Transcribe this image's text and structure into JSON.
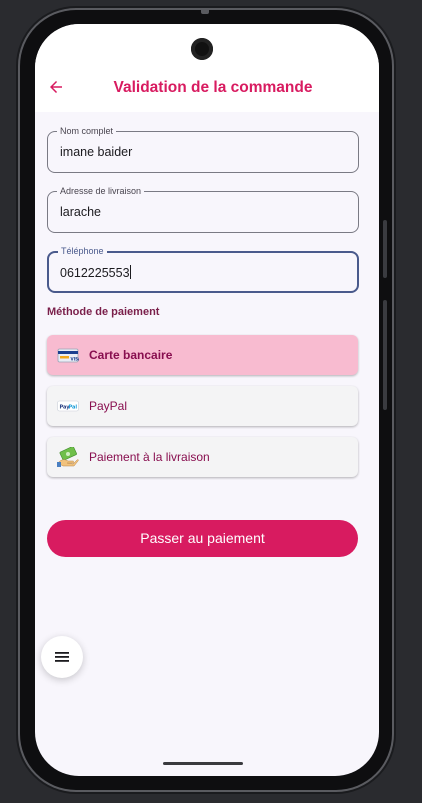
{
  "app_bar": {
    "title": "Validation de la commande",
    "back_icon": "arrow-left-icon"
  },
  "form": {
    "full_name": {
      "label": "Nom complet",
      "value": "imane baider"
    },
    "address": {
      "label": "Adresse de livraison",
      "value": "larache"
    },
    "phone": {
      "label": "Téléphone",
      "value": "0612225553"
    }
  },
  "payment": {
    "title": "Méthode de paiement",
    "options": [
      {
        "label": "Carte bancaire",
        "icon": "credit-card-icon",
        "selected": true
      },
      {
        "label": "PayPal",
        "icon": "paypal-icon",
        "selected": false
      },
      {
        "label": "Paiement à la livraison",
        "icon": "cash-icon",
        "selected": false
      }
    ]
  },
  "submit": {
    "label": "Passer au paiement"
  },
  "fab": {
    "icon": "menu-icon"
  },
  "colors": {
    "accent": "#d81b60",
    "selected_bg": "#f8bbd0",
    "option_text": "#880e4f"
  }
}
